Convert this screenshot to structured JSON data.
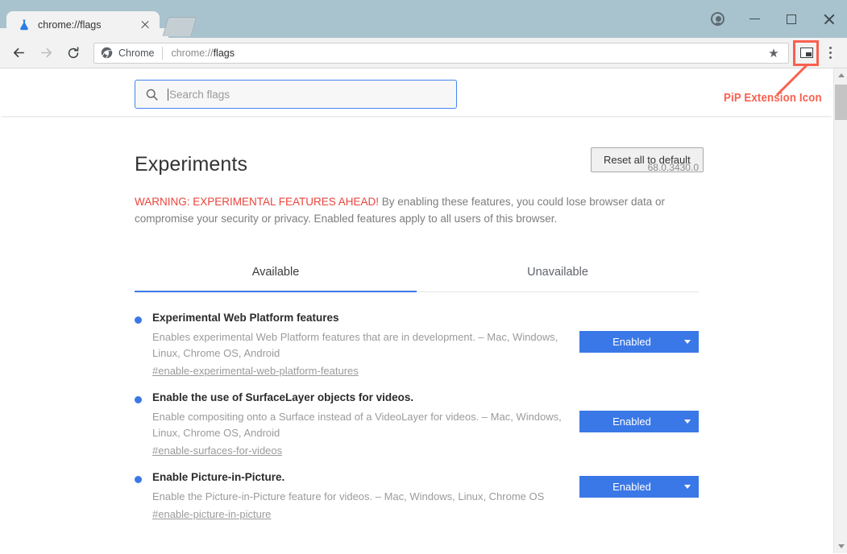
{
  "window": {
    "tab": {
      "title": "chrome://flags",
      "favicon": "flask-icon",
      "close": "close-icon"
    },
    "newtab_button": "new-tab-button",
    "controls": {
      "profile": "profile-avatar-icon",
      "minimize": "minimize-icon",
      "maximize": "maximize-icon",
      "close": "close-icon"
    }
  },
  "toolbar": {
    "back": "back-arrow-icon",
    "forward": "forward-arrow-icon",
    "reload": "reload-icon",
    "omnibox": {
      "chrome_icon": "chrome-logo-icon",
      "secure_label": "Chrome",
      "url_prefix": "chrome://",
      "url_page": "flags",
      "star": "★"
    },
    "extension_icon": "picture-in-picture-icon",
    "menu": "three-dot-menu-icon"
  },
  "flags_page": {
    "search": {
      "placeholder": "Search flags",
      "value": "",
      "icon": "search-icon"
    },
    "reset_button": "Reset all to default",
    "heading": "Experiments",
    "version": "68.0.3430.0",
    "warning_strong": "WARNING: EXPERIMENTAL FEATURES AHEAD!",
    "warning_body": " By enabling these features, you could lose browser data or compromise your security or privacy. Enabled features apply to all users of this browser.",
    "tabs": [
      {
        "label": "Available",
        "active": true
      },
      {
        "label": "Unavailable",
        "active": false
      }
    ],
    "flags": [
      {
        "name": "Experimental Web Platform features",
        "description": "Enables experimental Web Platform features that are in development. – Mac, Windows, Linux, Chrome OS, Android",
        "hash": "#enable-experimental-web-platform-features",
        "state": "Enabled"
      },
      {
        "name": "Enable the use of SurfaceLayer objects for videos.",
        "description": "Enable compositing onto a Surface instead of a VideoLayer for videos. – Mac, Windows, Linux, Chrome OS, Android",
        "hash": "#enable-surfaces-for-videos",
        "state": "Enabled"
      },
      {
        "name": "Enable Picture-in-Picture.",
        "description": "Enable the Picture-in-Picture feature for videos. – Mac, Windows, Linux, Chrome OS",
        "hash": "#enable-picture-in-picture",
        "state": "Enabled"
      }
    ]
  },
  "annotation": {
    "text": "PiP Extension Icon",
    "color": "#f9604e"
  },
  "colors": {
    "titlebar": "#a9c3ce",
    "toolbar": "#f2f2f2",
    "accent_blue": "#3b78e7",
    "warning_red": "#e8453c",
    "annotation_red": "#f9604e"
  }
}
